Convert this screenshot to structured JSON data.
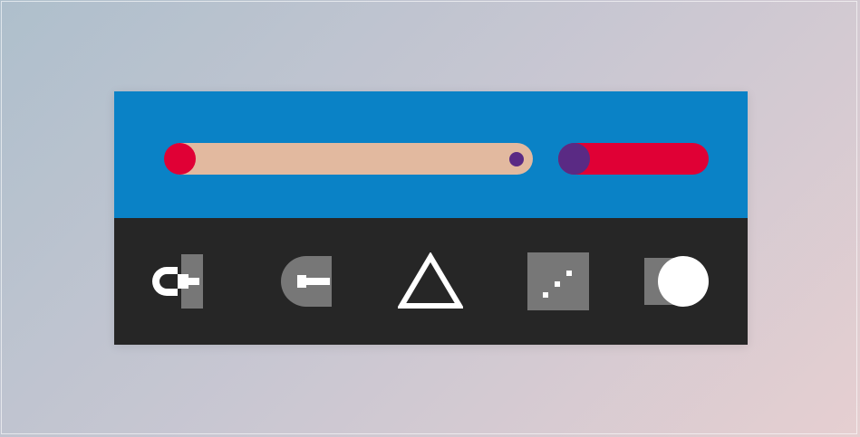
{
  "colors": {
    "background_start": "#aebfcc",
    "background_end": "#e6cfd1",
    "top_panel": "#0a82c6",
    "bottom_panel": "#262626",
    "slider_track": "#e2b99f",
    "slider_start_knob": "#e00035",
    "slider_end_knob": "#5a2a84",
    "toggle_track": "#e00035",
    "toggle_knob": "#5a2a84",
    "tool_gray": "#777777",
    "tool_white": "#ffffff"
  },
  "controls": {
    "slider": {
      "value_fraction": 0.0
    },
    "toggle": {
      "state": "off"
    }
  },
  "tools": [
    {
      "icon": "magnet-icon"
    },
    {
      "icon": "half-round-tab-icon"
    },
    {
      "icon": "triangle-icon"
    },
    {
      "icon": "dotted-square-icon"
    },
    {
      "icon": "circle-square-icon"
    }
  ]
}
